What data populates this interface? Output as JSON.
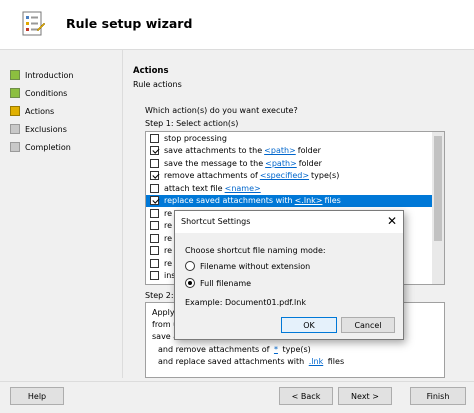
{
  "header": {
    "title": "Rule setup wizard",
    "icon": "wizard-icon"
  },
  "sidebar": {
    "steps": [
      {
        "label": "Introduction",
        "state": "done"
      },
      {
        "label": "Conditions",
        "state": "done"
      },
      {
        "label": "Actions",
        "state": "current"
      },
      {
        "label": "Exclusions",
        "state": "todo"
      },
      {
        "label": "Completion",
        "state": "todo"
      }
    ]
  },
  "main": {
    "section_title": "Actions",
    "section_subtitle": "Rule actions",
    "question": "Which action(s) do you want execute?",
    "step1_label": "Step 1: Select action(s)",
    "step2_label": "Step 2:",
    "actions": [
      {
        "checked": false,
        "pre": "stop processing",
        "link": "",
        "post": ""
      },
      {
        "checked": true,
        "pre": "save attachments to the",
        "link": "<path>",
        "post": "folder"
      },
      {
        "checked": false,
        "pre": "save the message to the",
        "link": "<path>",
        "post": "folder"
      },
      {
        "checked": true,
        "pre": "remove attachments of",
        "link": "<specified>",
        "post": "type(s)"
      },
      {
        "checked": false,
        "pre": "attach text file",
        "link": "<name>",
        "post": ""
      },
      {
        "checked": true,
        "pre": "replace saved attachments with",
        "link": "<.lnk>",
        "post": "files",
        "selected": true
      },
      {
        "checked": false,
        "pre": "re",
        "link": "",
        "post": ""
      },
      {
        "checked": false,
        "pre": "re",
        "link": "",
        "post": ""
      },
      {
        "checked": false,
        "pre": "re",
        "link": "",
        "post": ""
      },
      {
        "checked": false,
        "pre": "re",
        "link": "",
        "post": ""
      },
      {
        "checked": false,
        "pre": "re",
        "link": "",
        "post": ""
      },
      {
        "checked": false,
        "pre": "ins",
        "link": "",
        "post": ""
      }
    ],
    "description_lines": [
      {
        "pre": "Apply t",
        "link": "",
        "post": ""
      },
      {
        "pre": "from u",
        "link": "",
        "post": ""
      },
      {
        "pre": "save a",
        "link": "",
        "post": ""
      },
      {
        "pre": "and remove attachments of",
        "link": "*",
        "post": "type(s)",
        "indent": true
      },
      {
        "pre": "and replace saved attachments with",
        "link": ".lnk",
        "post": "files",
        "indent": true
      }
    ]
  },
  "footer": {
    "help_label": "Help",
    "back_label": "< Back",
    "next_label": "Next >",
    "finish_label": "Finish"
  },
  "dialog": {
    "title": "Shortcut Settings",
    "close_glyph": "✕",
    "prompt": "Choose shortcut file naming mode:",
    "option_without_ext": "Filename without extension",
    "option_full": "Full filename",
    "selected_option": "full",
    "example": "Example: Document01.pdf.lnk",
    "ok_label": "OK",
    "cancel_label": "Cancel"
  }
}
